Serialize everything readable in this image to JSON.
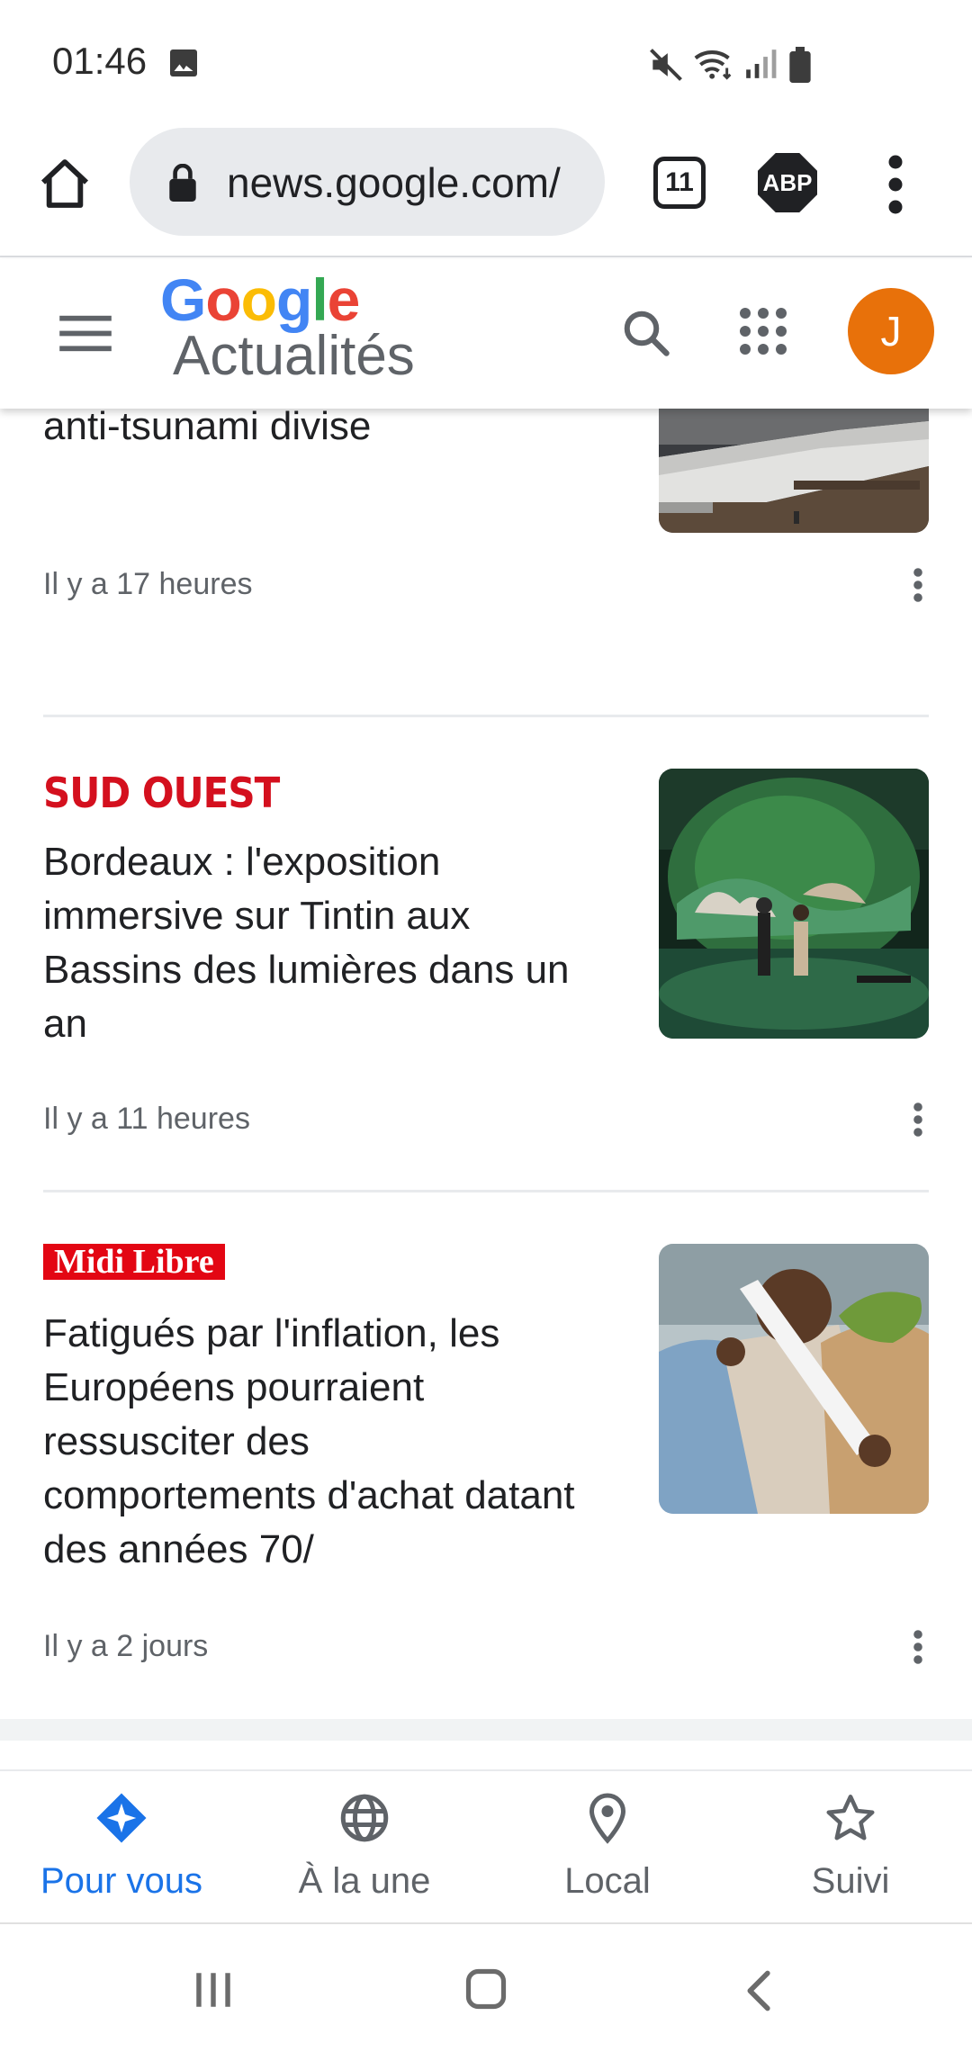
{
  "status_bar": {
    "time": "01:46",
    "icons": [
      "gallery-icon",
      "mute-icon",
      "wifi-icon",
      "signal-icon",
      "battery-icon"
    ]
  },
  "browser": {
    "url": "news.google.com/",
    "tab_count": "11",
    "abp_label": "ABP"
  },
  "header": {
    "logo_google": "Google",
    "logo_sub": "Actualités",
    "avatar_letter": "J",
    "avatar_color": "#e8710a"
  },
  "articles": [
    {
      "source": "",
      "title": "Au Japon, le gigantesque mur anti-tsunami divise",
      "time": "Il y a 17 heures",
      "thumb_icon": "seawall-photo"
    },
    {
      "source": "SUD OUEST",
      "title": "Bordeaux : l'exposition immersive sur Tintin aux Bassins des lumières dans un an",
      "time": "Il y a 11 heures",
      "thumb_icon": "immersive-exhibition-photo"
    },
    {
      "source": "Midi Libre",
      "title": "Fatigués par l'inflation, les Européens pourraient ressusciter des comportements d'achat datant des années 70/",
      "time": "Il y a 2 jours",
      "thumb_icon": "shopping-receipt-photo"
    }
  ],
  "bottom_nav": [
    {
      "label": "Pour vous",
      "icon": "for-you-icon",
      "active": true
    },
    {
      "label": "À la une",
      "icon": "globe-icon",
      "active": false
    },
    {
      "label": "Local",
      "icon": "location-pin-icon",
      "active": false
    },
    {
      "label": "Suivi",
      "icon": "star-icon",
      "active": false
    }
  ],
  "colors": {
    "accent": "#1a73e8",
    "sud_ouest": "#d4101e",
    "midi_libre": "#e30613"
  }
}
